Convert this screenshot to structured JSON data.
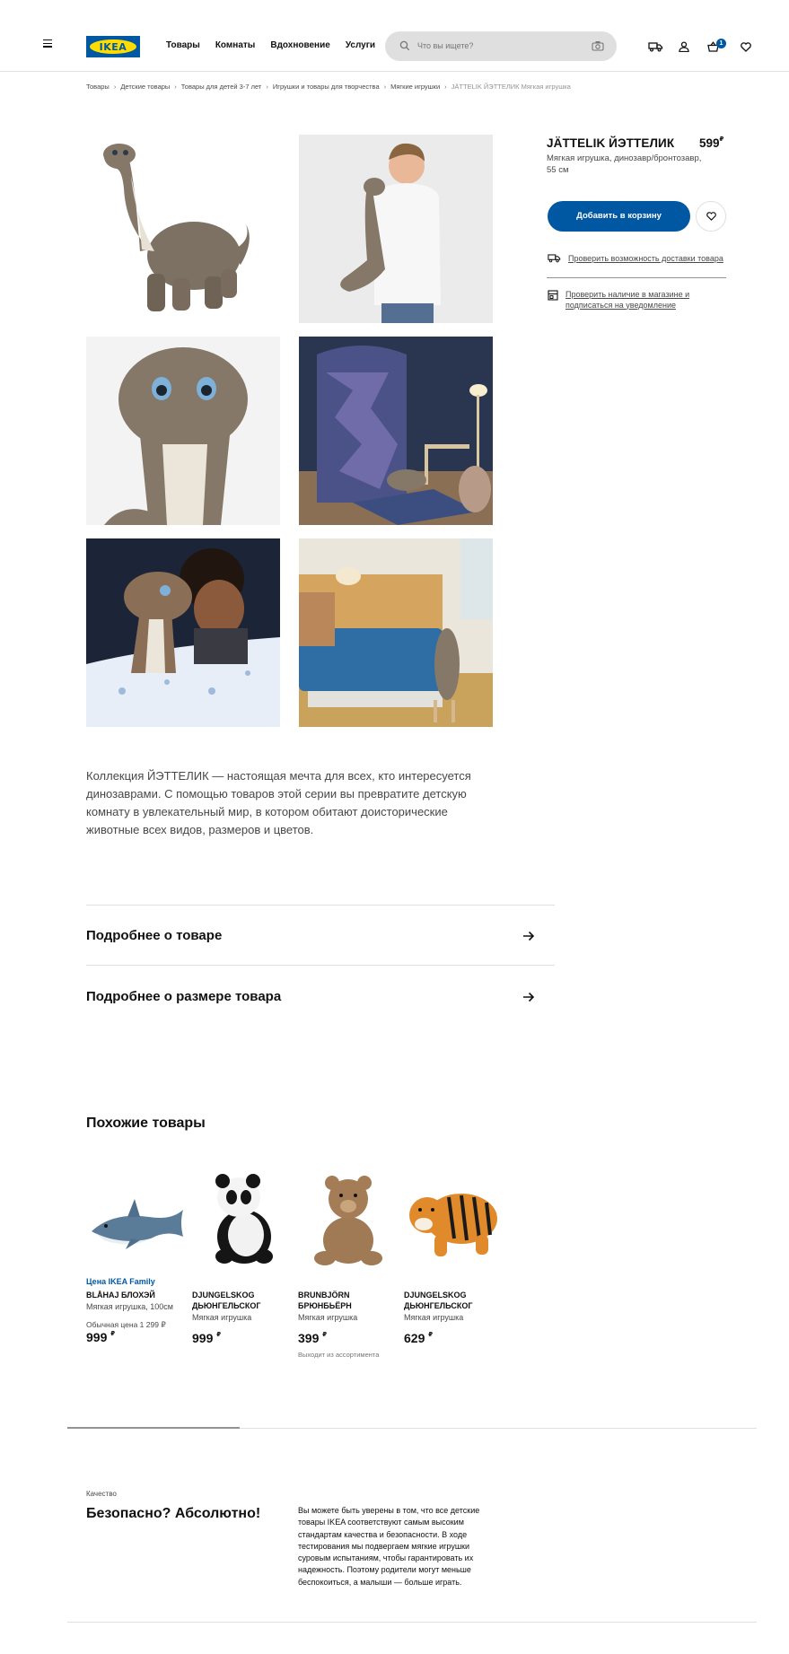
{
  "header": {
    "logo_text": "IKEA",
    "nav": [
      "Товары",
      "Комнаты",
      "Вдохновение",
      "Услуги"
    ],
    "search_placeholder": "Что вы ищете?",
    "cart_count": "1"
  },
  "breadcrumb": [
    "Товары",
    "Детские товары",
    "Товары для детей 3-7 лет",
    "Игрушки и товары для творчества",
    "Мягкие игрушки",
    "JÄTTELIK ЙЭТТЕЛИК Мягкая игрушка"
  ],
  "product": {
    "name": "JÄTTELIK ЙЭТТЕЛИК",
    "price": "599",
    "currency": "₽",
    "description": "Мягкая игрушка, динозавр/бронтозавр, 55 см",
    "add_to_cart": "Добавить в корзину",
    "delivery_link": "Проверить возможность доставки товара",
    "stock_link": "Проверить наличие в магазине и подписаться на уведомление",
    "long_description": "Коллекция ЙЭТТЕЛИК — настоящая мечта для всех, кто интересуется динозаврами. С помощью товаров этой серии вы превратите детскую комнату в увлекательный мир, в котором обитают доисторические животные всех видов, размеров и цветов."
  },
  "accordion": [
    "Подробнее о товаре",
    "Подробнее о размере товара"
  ],
  "similar": {
    "title": "Похожие товары",
    "items": [
      {
        "family": "Цена IKEA Family",
        "name": "BLÅHAJ БЛОХЭЙ",
        "desc": "Мягкая игрушка, 100см",
        "old_price": "Обычная цена 1 299 ₽",
        "price": "999",
        "note": ""
      },
      {
        "family": "",
        "name": "DJUNGELSKOG ДЬЮНГЕЛЬСКОГ",
        "desc": "Мягкая игрушка",
        "old_price": "",
        "price": "999",
        "note": ""
      },
      {
        "family": "",
        "name": "BRUNBJÖRN БРЮНБЬЁРН",
        "desc": "Мягкая игрушка",
        "old_price": "",
        "price": "399",
        "note": "Выходит из ассортимента"
      },
      {
        "family": "",
        "name": "DJUNGELSKOG ДЬЮНГЕЛЬСКОГ",
        "desc": "Мягкая игрушка",
        "old_price": "",
        "price": "629",
        "note": ""
      }
    ]
  },
  "quality": {
    "label": "Качество",
    "title": "Безопасно? Абсолютно!",
    "text": "Вы можете быть уверены в том, что все детские товары IKEA соответствуют самым высоким стандартам качества и безопасности. В ходе тестирования мы подвергаем мягкие игрушки суровым испытаниям, чтобы гарантировать их надежность. Поэтому родители могут меньше беспокоиться, а малыши — больше играть."
  },
  "colors": {
    "brand_blue": "#0058a3",
    "brand_yellow": "#ffdb00"
  },
  "icons": [
    "menu-icon",
    "search-icon",
    "camera-icon",
    "truck-icon",
    "user-icon",
    "basket-icon",
    "heart-icon",
    "store-icon",
    "arrow-right-icon"
  ]
}
